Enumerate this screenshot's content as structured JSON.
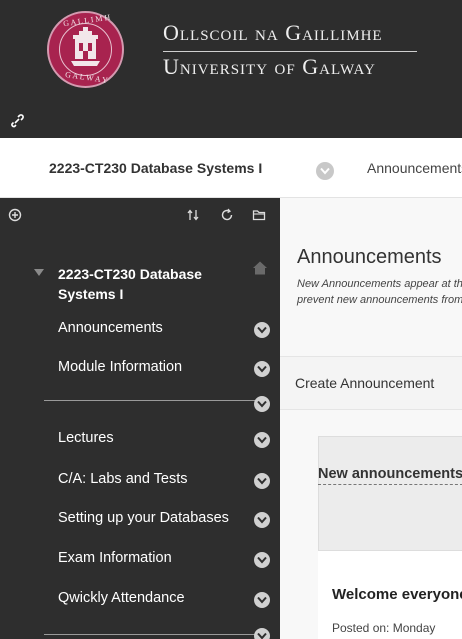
{
  "header": {
    "line1": "Ollscoil na Gaillimhe",
    "line2": "University of Galway",
    "seal_text": [
      "G A L L I M H",
      "G A L W A Y"
    ],
    "colors": {
      "background": "#2d2d2d",
      "seal": "#a8234f"
    }
  },
  "breadcrumb": {
    "course": "2223-CT230 Database Systems I",
    "current_page": "Announcements"
  },
  "sidebar": {
    "course_title": "2223-CT230 Database Systems I",
    "items": [
      {
        "label": "Announcements"
      },
      {
        "label": "Module Information"
      },
      {
        "label": "Lectures"
      },
      {
        "label": "C/A: Labs and Tests"
      },
      {
        "label": "Setting up your Databases"
      },
      {
        "label": "Exam Information"
      },
      {
        "label": "Qwickly Attendance"
      }
    ]
  },
  "content": {
    "title": "Announcements",
    "description_line1": "New Announcements appear at the top of the list. You can",
    "description_line2": "prevent new announcements from being shown to users.",
    "action_button": "Create Announcement",
    "panel_heading": "New announcements",
    "announcement_title": "Welcome everyone",
    "posted_on": "Posted on: Monday"
  }
}
